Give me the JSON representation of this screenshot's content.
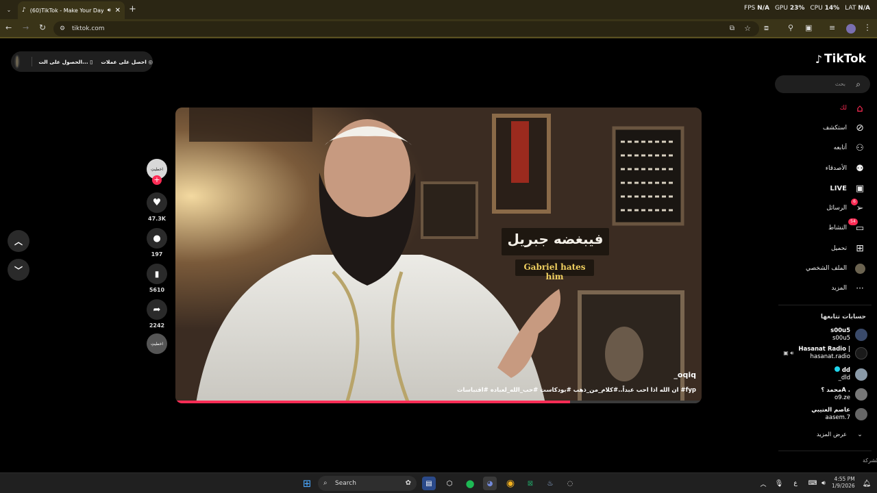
{
  "browser": {
    "tab_title": "(60)TikTok - Make Your Day",
    "url": "tiktok.com",
    "perf": {
      "fps_label": "FPS",
      "fps_value": "N/A",
      "gpu_label": "GPU",
      "gpu_value": "23",
      "cpu_label": "CPU",
      "cpu_value": "14",
      "lat_label": "LAT",
      "lat_value": "N/A",
      "pct": "%"
    }
  },
  "promo": {
    "coins": "احصل على عملات",
    "app": "الحصول على الت..."
  },
  "video": {
    "caption_ar": "فيبغضه جبريل",
    "caption_en": "Gabriel hates him",
    "author": "_oqiq",
    "description": "ان الله اذا احب عبداً..#كلام_من_ذهب #بودكاست #حب_الله_لعباده #اقتباسات #fyp",
    "progress": 0.75
  },
  "actions": {
    "avatar_text": "اخطیتِ",
    "likes": "47.3K",
    "comments": "197",
    "saves": "5610",
    "shares": "2242",
    "music_text": "اخطیتِ"
  },
  "sidebar": {
    "logo": "TikTok",
    "search_placeholder": "بحث",
    "nav": {
      "foryou": "لك",
      "explore": "استكشف",
      "following": "أتابعه",
      "friends": "الأصدقاء",
      "live": "LIVE",
      "messages": "الرسائل",
      "messages_badge": "6",
      "activity": "النشاط",
      "activity_badge": "54",
      "upload": "تحميل",
      "profile": "الملف الشخصي",
      "more": "المزيد"
    },
    "following_heading": "حسابات تتابعها",
    "accounts": [
      {
        "name": "s00u5",
        "handle": "s00u5"
      },
      {
        "name": "Hasanat Radio |",
        "handle": "hasanat.radio"
      },
      {
        "name": "dd",
        "handle": "_dld"
      },
      {
        "name": "محمد ؟A .",
        "handle": "o9.ze"
      },
      {
        "name": "عاصم العتيبي",
        "handle": "aasem.7"
      }
    ],
    "see_more": "عرض المزيد",
    "company": "الشركة"
  },
  "taskbar": {
    "search": "Search",
    "lang": "ع",
    "time": "4:55 PM",
    "date": "1/9/2026"
  },
  "colors": {
    "accent": "#fe2c55",
    "browser_frame": "#3a3418",
    "caption_box": "#1e1710",
    "caption_en": "#f0d060"
  }
}
